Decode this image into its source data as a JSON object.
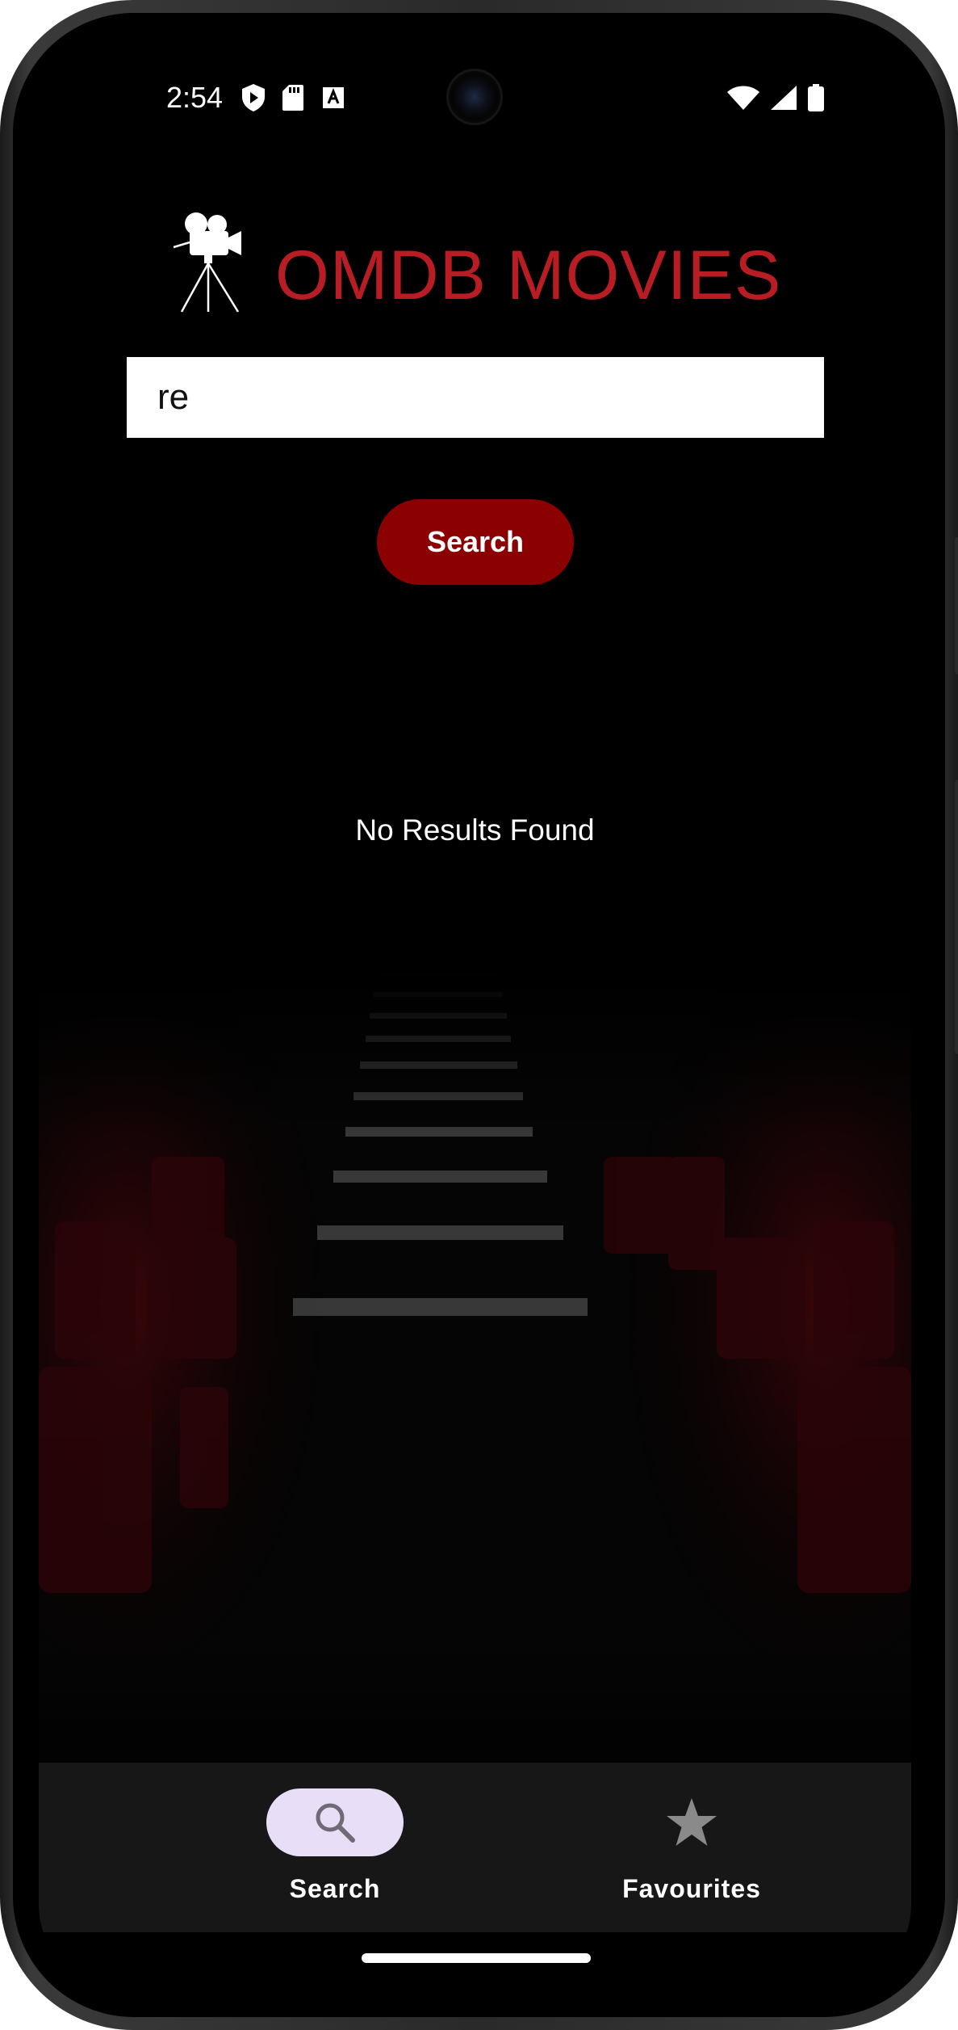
{
  "status_bar": {
    "time": "2:54",
    "left_icons": [
      "play-protect-icon",
      "sd-card-icon",
      "text-a-icon"
    ],
    "right_icons": [
      "wifi-icon",
      "cellular-signal-icon",
      "battery-icon"
    ]
  },
  "header": {
    "logo_icon": "movie-camera-tripod-icon",
    "title": "OMDB MOVIES",
    "title_color": "#b81d24"
  },
  "search": {
    "value": "re",
    "button_label": "Search",
    "button_color": "#8b0000"
  },
  "results": {
    "message": "No Results Found"
  },
  "bottom_nav": {
    "items": [
      {
        "label": "Search",
        "icon": "search-icon",
        "selected": true
      },
      {
        "label": "Favourites",
        "icon": "star-icon",
        "selected": false
      }
    ],
    "pill_color": "#e8def8"
  }
}
